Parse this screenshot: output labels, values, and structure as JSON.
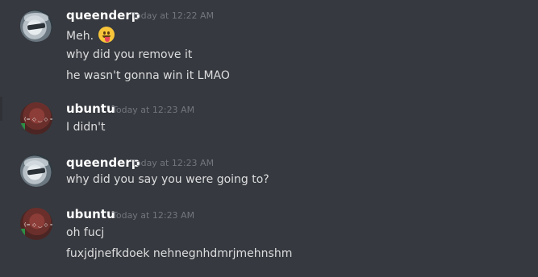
{
  "messages": [
    {
      "username": "queenderp",
      "timestamp": "Today at 12:22 AM",
      "avatar": "metal-gear-avatar",
      "lines": [
        "Meh.",
        "why did you remove it",
        "he wasn't gonna win it LMAO"
      ],
      "emoji": "tongue-out-emoji"
    },
    {
      "username": "ubuntu",
      "timestamp": "Today at 12:23 AM",
      "avatar": "red-face-avatar",
      "avatar_text": "(= ◇ ‿ ◇ =)",
      "lines": [
        "I didn't"
      ]
    },
    {
      "username": "queenderp",
      "timestamp": "Today at 12:23 AM",
      "avatar": "metal-gear-avatar",
      "lines": [
        "why did you say you were going to?"
      ]
    },
    {
      "username": "ubuntu",
      "timestamp": "Today at 12:23 AM",
      "avatar": "red-face-avatar",
      "avatar_text": "(= ◇ ‿ ◇ =)",
      "lines": [
        "oh fucj",
        "fuxjdjnefkdoek nehnegnhdmrjmehnshm"
      ]
    }
  ],
  "colors": {
    "background": "#36393f",
    "username": "#ffffff",
    "timestamp": "#72767d",
    "message_text": "#dcddde"
  }
}
